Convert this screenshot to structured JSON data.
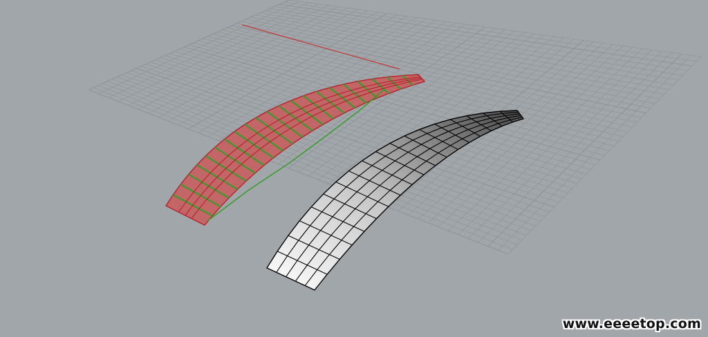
{
  "viewport": {
    "background": "#a1a6ab",
    "grid_color": "#8f9499",
    "axis_x_color": "#c23b3b",
    "axis_y_color": "#3aa13a"
  },
  "objects": [
    {
      "name": "selected-surface",
      "state": "selected",
      "fill": "#d06a6a",
      "edge": "#b5202a",
      "isocurve": "#3a9a2a"
    },
    {
      "name": "mesh-surface",
      "state": "unselected",
      "shading": "white-to-gray",
      "edge": "#000000"
    }
  ],
  "watermark": {
    "text": "www.eeeetop.com"
  }
}
